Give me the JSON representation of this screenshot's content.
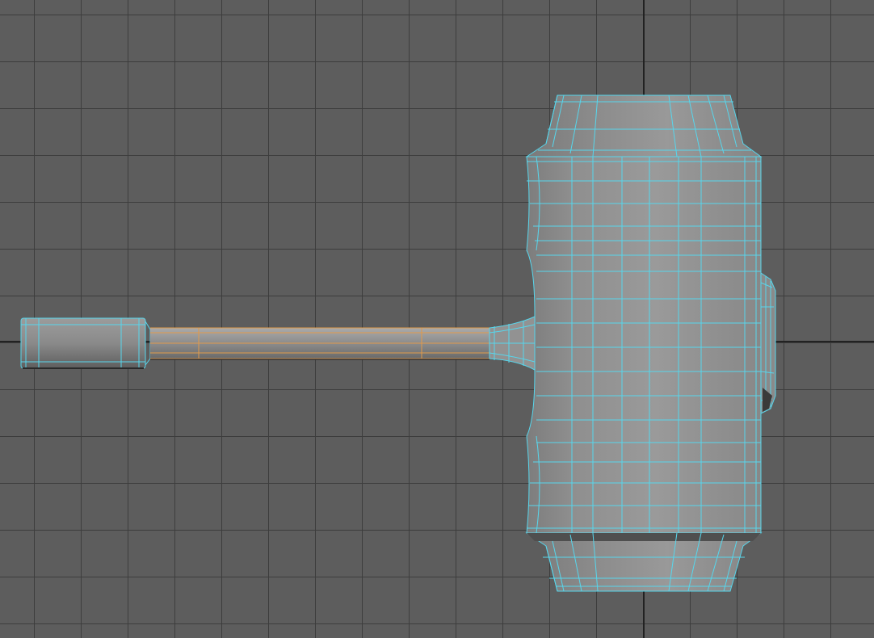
{
  "viewport": {
    "grid_color": "#3d3d3d",
    "background_color": "#5d5d5d",
    "axis_color": "#222222",
    "wireframe_color": "#57d6ec",
    "selection_color": "#e09a4c"
  },
  "model": {
    "parts": [
      "handle-pommel",
      "handle-shaft",
      "handle-neck",
      "hammer-head",
      "head-side-detail"
    ],
    "selected_part": "handle-shaft"
  }
}
